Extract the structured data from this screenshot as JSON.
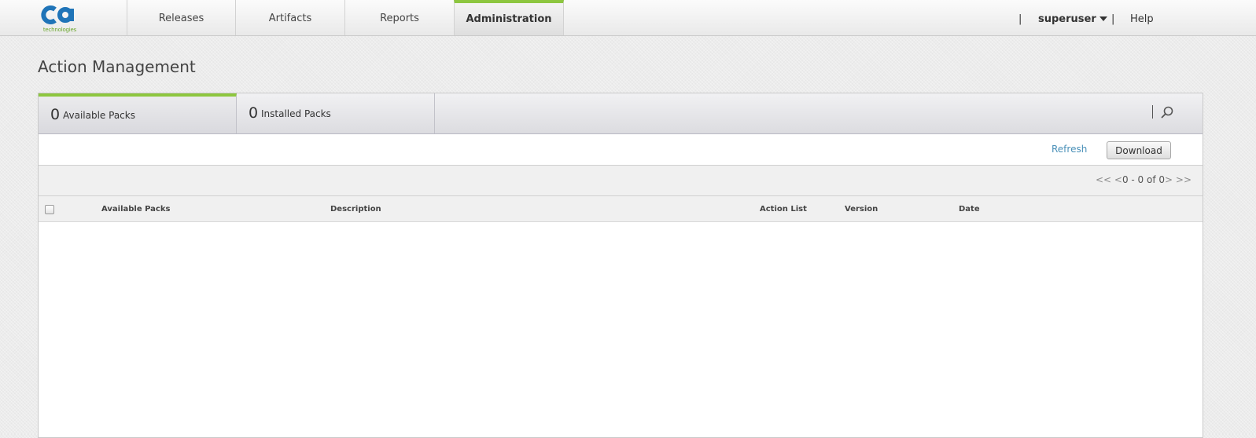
{
  "brand": {
    "logo_text": "ca",
    "logo_caption": "technologies",
    "accent_color": "#8dc63f",
    "logo_blue": "#1f74b8"
  },
  "nav": {
    "tabs": [
      {
        "label": "Releases"
      },
      {
        "label": "Artifacts"
      },
      {
        "label": "Reports"
      },
      {
        "label": "Administration",
        "active": true
      }
    ],
    "separator": "|",
    "user": "superuser",
    "help": "Help"
  },
  "page": {
    "title": "Action Management"
  },
  "pack_tabs": [
    {
      "count": "0",
      "label": "Available Packs",
      "active": true
    },
    {
      "count": "0",
      "label": "Installed Packs",
      "active": false
    }
  ],
  "toolbar": {
    "refresh_label": "Refresh",
    "download_label": "Download",
    "search_icon": "search-icon"
  },
  "pager": {
    "first": "<<",
    "prev": "<",
    "range": "0 - 0 of 0",
    "next": ">",
    "last": ">>"
  },
  "table": {
    "columns": [
      "Available Packs",
      "Description",
      "Action List",
      "Version",
      "Date"
    ],
    "rows": []
  }
}
